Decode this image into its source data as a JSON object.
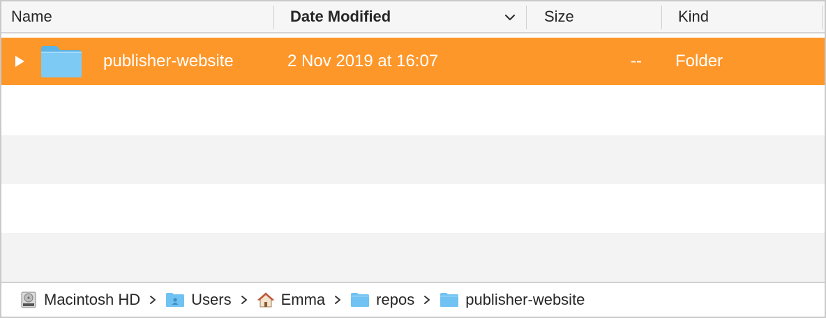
{
  "columns": {
    "name": "Name",
    "date_modified": "Date Modified",
    "size": "Size",
    "kind": "Kind",
    "sort_indicator_icon": "chevron-down-icon"
  },
  "files": [
    {
      "name": "publisher-website",
      "date_modified": "2 Nov 2019 at 16:07",
      "size": "--",
      "kind": "Folder",
      "icon": "folder-icon",
      "selected": true,
      "expanded": false
    }
  ],
  "path_bar": [
    {
      "label": "Macintosh HD",
      "icon": "hard-drive-icon"
    },
    {
      "label": "Users",
      "icon": "users-folder-icon"
    },
    {
      "label": "Emma",
      "icon": "home-icon"
    },
    {
      "label": "repos",
      "icon": "folder-icon"
    },
    {
      "label": "publisher-website",
      "icon": "folder-icon"
    }
  ],
  "colors": {
    "selection": "#fe9729",
    "folder_blue": "#6fc2f2",
    "stripe": "#f3f3f3"
  }
}
